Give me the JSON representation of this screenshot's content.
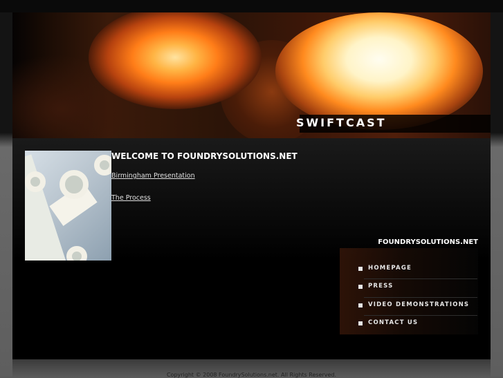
{
  "site_title": "SWIFTCAST",
  "main": {
    "heading": "WELCOME TO FOUNDRYSOLUTIONS.NET",
    "links": [
      "Birmingham Presentation",
      "The Process"
    ]
  },
  "sidebar": {
    "heading": "FOUNDRYSOLUTIONS.NET",
    "nav": [
      "HOMEPAGE",
      "PRESS",
      "VIDEO DEMONSTRATIONS",
      "CONTACT US"
    ]
  },
  "footer": {
    "copyright": "Copyright © 2008 FoundrySolutions.net. All Rights Reserved."
  },
  "colors": {
    "background": "#000000",
    "text": "#ffffff",
    "accent_glow": "#ff8a1e"
  },
  "icons": {
    "nav_bullet": "square-bullet-icon"
  }
}
